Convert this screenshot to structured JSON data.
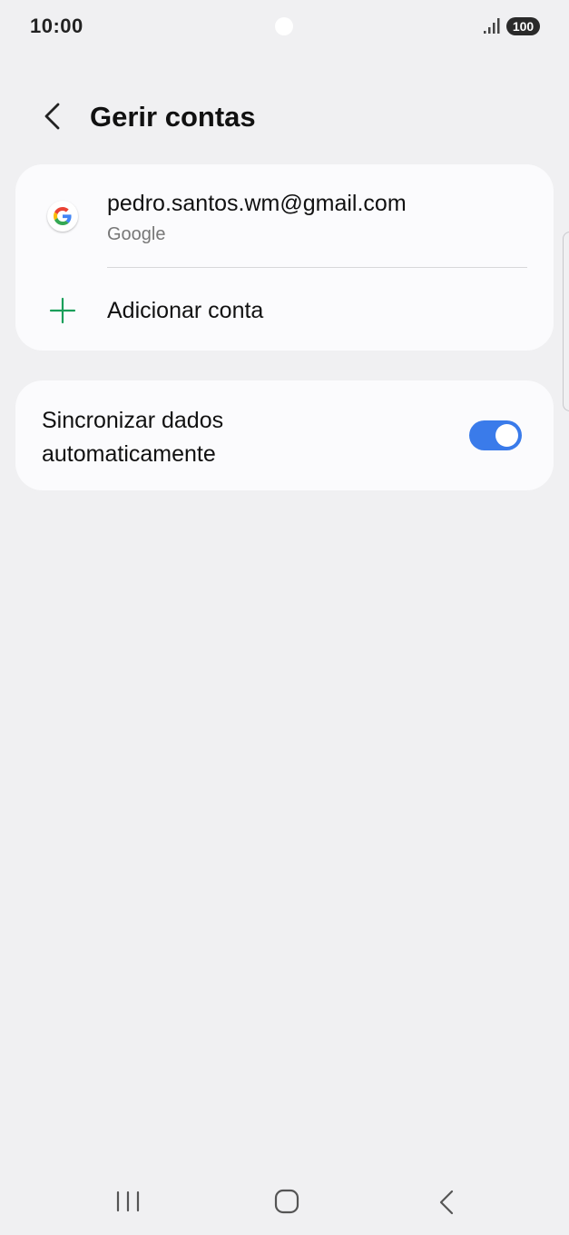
{
  "status_bar": {
    "time": "10:00",
    "battery": "100",
    "signal_icon": "signal-bars-icon"
  },
  "header": {
    "back_icon": "chevron-left-icon",
    "title": "Gerir contas"
  },
  "accounts": {
    "items": [
      {
        "icon": "google-logo-icon",
        "email": "pedro.santos.wm@gmail.com",
        "type": "Google"
      }
    ],
    "add_account": {
      "icon": "plus-icon",
      "label": "Adicionar conta"
    }
  },
  "sync": {
    "label": "Sincronizar dados automaticamente",
    "enabled": true
  },
  "nav_bar": {
    "recents_icon": "recents-icon",
    "home_icon": "home-icon",
    "back_icon": "back-icon"
  },
  "colors": {
    "background": "#f0f0f2",
    "card": "#fbfbfd",
    "accent": "#3a7bea",
    "plus_green": "#1a9e5a",
    "secondary_text": "#777777"
  }
}
